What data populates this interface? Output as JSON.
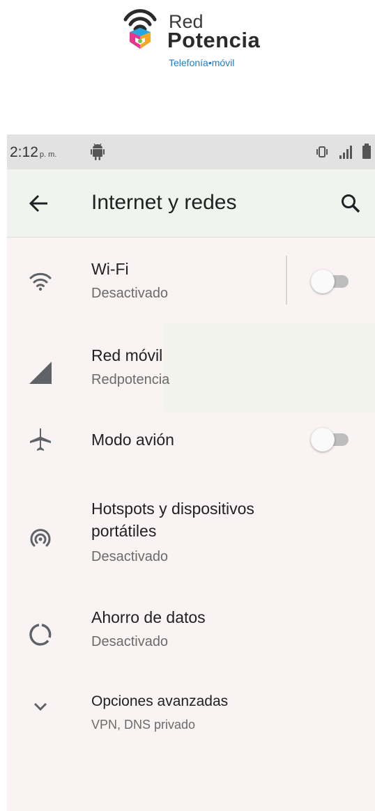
{
  "logo": {
    "name_line1": "Red",
    "name_line2": "Potencia",
    "tagline": "Telefonía•móvil",
    "brand_colors": [
      "#e8368f",
      "#2aa6df",
      "#f5a623",
      "#7ac143",
      "#8a3ab9"
    ]
  },
  "status_bar": {
    "time": "2:12",
    "time_suffix": "p. m.",
    "icons": [
      "android-icon",
      "vibrate-icon",
      "signal-icon",
      "battery-icon"
    ]
  },
  "app_bar": {
    "title": "Internet y redes",
    "back_icon": "arrow-back-icon",
    "search_icon": "search-icon"
  },
  "items": [
    {
      "icon": "wifi-icon",
      "title": "Wi-Fi",
      "subtitle": "Desactivado",
      "toggle": "off"
    },
    {
      "icon": "cellular-signal-icon",
      "title": "Red móvil",
      "subtitle": "Redpotencia"
    },
    {
      "icon": "airplane-icon",
      "title": "Modo avión",
      "toggle": "off"
    },
    {
      "icon": "hotspot-icon",
      "title_line1": "Hotspots y dispositivos",
      "title_line2": "portátiles",
      "subtitle": "Desactivado"
    },
    {
      "icon": "data-saver-icon",
      "title": "Ahorro de datos",
      "subtitle": "Desactivado"
    },
    {
      "icon": "chevron-down-icon",
      "title": "Opciones avanzadas",
      "subtitle": "VPN, DNS privado"
    }
  ],
  "colors": {
    "screen_background": "#faf3f3",
    "status_bar": "#e2e2e2",
    "app_bar": "#f1f3ee",
    "icon_gray": "#5f6368",
    "toggle_off_track": "#bdbdbd"
  }
}
